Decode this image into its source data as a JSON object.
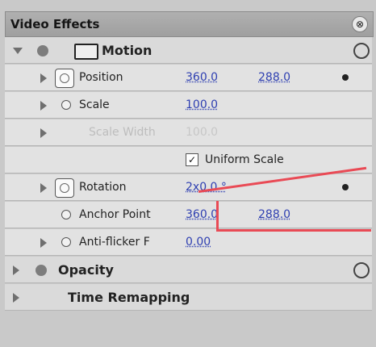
{
  "panel": {
    "title": "Video Effects",
    "header_button": "⊗"
  },
  "motion": {
    "label": "Motion"
  },
  "properties": {
    "position": {
      "label": "Position",
      "value1": "360.0",
      "value2": "288.0"
    },
    "scale": {
      "label": "Scale",
      "value": "100.0"
    },
    "scale_width": {
      "label": "Scale Width",
      "value": "100.0"
    },
    "uniform_scale": {
      "label": "Uniform Scale",
      "checked": true
    },
    "rotation": {
      "label": "Rotation",
      "value": "2x0.0 °"
    },
    "anchor_point": {
      "label": "Anchor Point",
      "value1": "360.0",
      "value2": "288.0"
    },
    "anti_flicker": {
      "label": "Anti-flicker F",
      "value": "0.00"
    }
  },
  "effects": {
    "opacity": {
      "label": "Opacity"
    },
    "time_remapping": {
      "label": "Time Remapping"
    }
  },
  "colors": {
    "value_blue": "#2e3fb1",
    "callout_red": "#e94a55"
  }
}
